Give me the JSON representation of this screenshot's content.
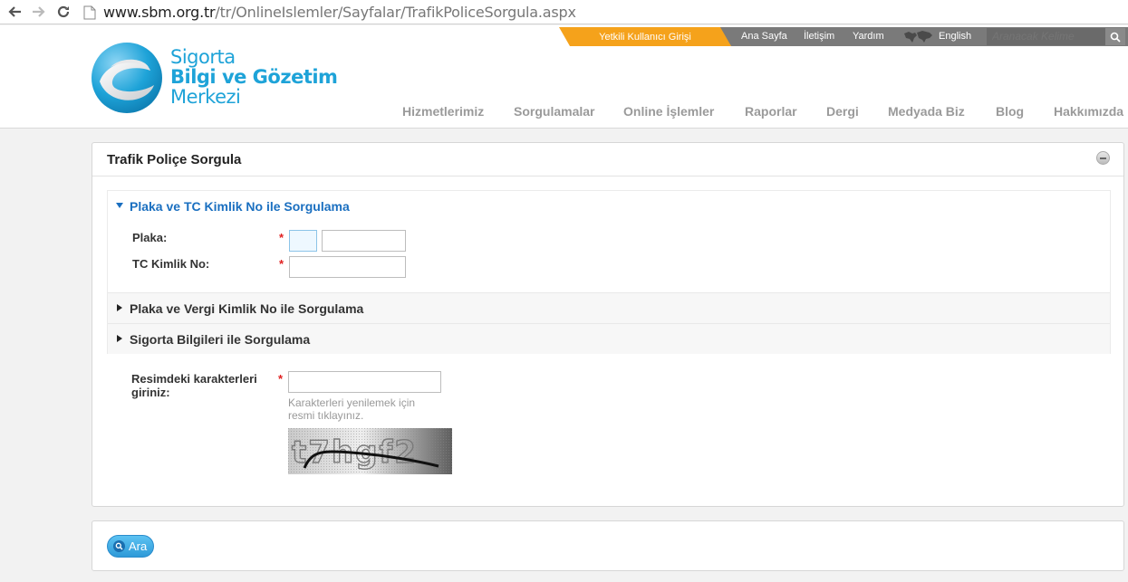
{
  "browser": {
    "url_domain": "www.sbm.org.tr",
    "url_path": "/tr/OnlineIslemler/Sayfalar/TrafikPoliceSorgula.aspx"
  },
  "logo": {
    "line1": "Sigorta",
    "line2": "Bilgi ve Gözetim",
    "line3": "Merkezi"
  },
  "topbar": {
    "login": "Yetkili Kullanıcı Girişi",
    "links": [
      "Ana Sayfa",
      "İletişim",
      "Yardım",
      "English"
    ],
    "search_placeholder": "Aranacak Kelime"
  },
  "nav": {
    "items": [
      "Hizmetlerimiz",
      "Sorgulamalar",
      "Online İşlemler",
      "Raporlar",
      "Dergi",
      "Medyada Biz",
      "Blog",
      "Hakkımızda"
    ]
  },
  "panel": {
    "title": "Trafik Poliçe Sorgula",
    "sections": [
      "Plaka ve TC Kimlik No ile Sorgulama",
      "Plaka ve Vergi Kimlik No ile Sorgulama",
      "Sigorta Bilgileri ile Sorgulama"
    ],
    "plaka_label": "Plaka:",
    "tc_label": "TC Kimlik No:",
    "required_mark": "*",
    "plaka_il_value": "",
    "plaka_no_value": "",
    "tc_value": "",
    "captcha_label_line1": "Resimdeki karakterleri",
    "captcha_label_line2": "giriniz:",
    "captcha_value": "",
    "captcha_hint_line1": "Karakterleri yenilemek için",
    "captcha_hint_line2": "resmi tıklayınız.",
    "captcha_text": "t7hgf2"
  },
  "actions": {
    "search_label": "Ara"
  },
  "colors": {
    "brand_blue": "#1ea3d8",
    "login_orange": "#f5a21b",
    "section_blue": "#1a6fc0",
    "required_red": "#e02020"
  }
}
